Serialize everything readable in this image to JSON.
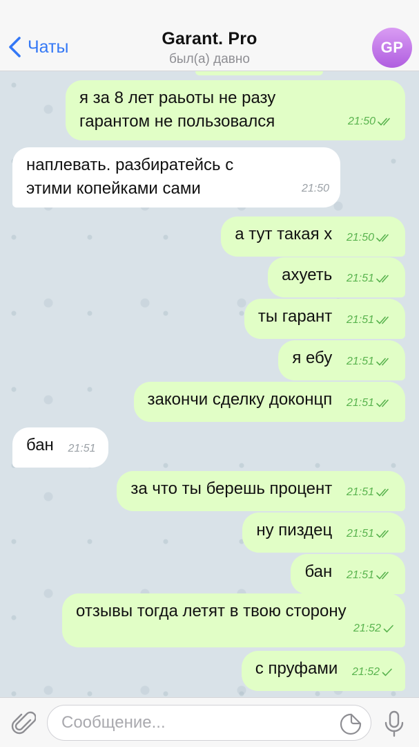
{
  "header": {
    "back_label": "Чаты",
    "title": "Garant. Pro",
    "subtitle": "был(а) давно",
    "avatar_initials": "GP"
  },
  "messages": [
    {
      "dir": "out",
      "text": "я за 8 лет раьоты не разу гарантом не пользовался",
      "time": "21:50",
      "status": "read"
    },
    {
      "dir": "in",
      "text": "наплевать. разбиратейсь с этими копейками сами",
      "time": "21:50"
    },
    {
      "dir": "out",
      "text": "а тут такая х",
      "time": "21:50",
      "status": "read"
    },
    {
      "dir": "out",
      "text": "ахуеть",
      "time": "21:51",
      "status": "read"
    },
    {
      "dir": "out",
      "text": "ты гарант",
      "time": "21:51",
      "status": "read"
    },
    {
      "dir": "out",
      "text": "я ебу",
      "time": "21:51",
      "status": "read"
    },
    {
      "dir": "out",
      "text": "закончи сделку доконцп",
      "time": "21:51",
      "status": "read"
    },
    {
      "dir": "in",
      "text": "бан",
      "time": "21:51"
    },
    {
      "dir": "out",
      "text": "за что ты берешь процент",
      "time": "21:51",
      "status": "read"
    },
    {
      "dir": "out",
      "text": "ну пиздец",
      "time": "21:51",
      "status": "read"
    },
    {
      "dir": "out",
      "text": "бан",
      "time": "21:51",
      "status": "read"
    },
    {
      "dir": "out",
      "text": "отзывы тогда летят  в твою сторону",
      "time": "21:52",
      "status": "sent"
    },
    {
      "dir": "out",
      "text": "с пруфами",
      "time": "21:52",
      "status": "sent"
    }
  ],
  "composer": {
    "placeholder": "Сообщение...",
    "attach_icon": "paperclip-icon",
    "sticker_icon": "sticker-icon",
    "mic_icon": "microphone-icon"
  },
  "colors": {
    "accent": "#3478f6",
    "outgoing_bubble": "#e1fec6",
    "incoming_bubble": "#ffffff",
    "outgoing_meta": "#59b34e",
    "chat_background": "#d9e2e8"
  }
}
